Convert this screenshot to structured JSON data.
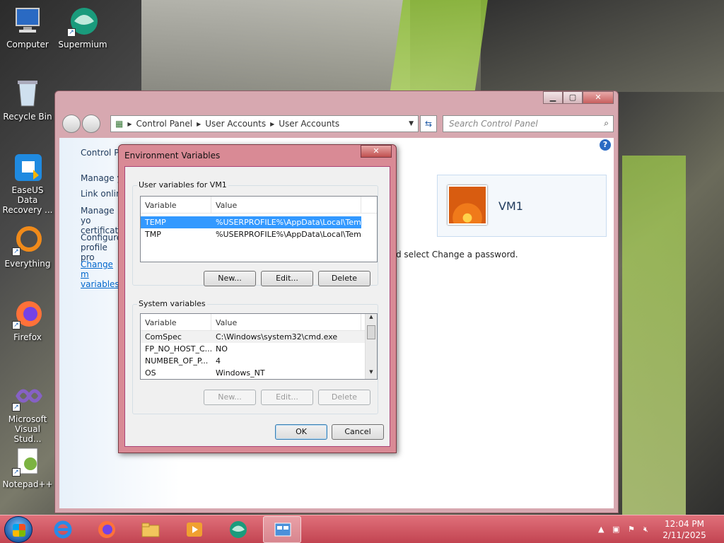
{
  "desktop": {
    "icons": [
      {
        "label": "Computer"
      },
      {
        "label": "Supermium"
      },
      {
        "label": "Recycle Bin"
      },
      {
        "label": "EaseUS Data Recovery ..."
      },
      {
        "label": "Everything"
      },
      {
        "label": "Firefox"
      },
      {
        "label": "Microsoft Visual Stud..."
      },
      {
        "label": "Notepad++"
      }
    ]
  },
  "window": {
    "breadcrumb": [
      "Control Panel",
      "User Accounts",
      "User Accounts"
    ],
    "search_placeholder": "Search Control Panel",
    "left_pane": {
      "items": [
        "Control Pa",
        "Manage yo",
        "Link onlin",
        "Manage yo certificate",
        "Configure profile pro"
      ],
      "link": "Change m variables"
    },
    "user": {
      "name": "VM1"
    },
    "body_text": "d select Change a password."
  },
  "dialog": {
    "title": "Environment Variables",
    "user_group_label": "User variables for VM1",
    "columns": [
      "Variable",
      "Value"
    ],
    "user_vars": [
      {
        "name": "TEMP",
        "value": "%USERPROFILE%\\AppData\\Local\\Temp"
      },
      {
        "name": "TMP",
        "value": "%USERPROFILE%\\AppData\\Local\\Temp"
      }
    ],
    "user_buttons": {
      "new": "New...",
      "edit": "Edit...",
      "delete": "Delete"
    },
    "system_group_label": "System variables",
    "system_vars": [
      {
        "name": "ComSpec",
        "value": "C:\\Windows\\system32\\cmd.exe"
      },
      {
        "name": "FP_NO_HOST_C...",
        "value": "NO"
      },
      {
        "name": "NUMBER_OF_P...",
        "value": "4"
      },
      {
        "name": "OS",
        "value": "Windows_NT"
      }
    ],
    "system_buttons": {
      "new": "New...",
      "edit": "Edit...",
      "delete": "Delete"
    },
    "ok": "OK",
    "cancel": "Cancel"
  },
  "taskbar": {
    "time": "12:04 PM",
    "date": "2/11/2025"
  },
  "colors": {
    "accent": "#c24451",
    "selection": "#3399ff"
  }
}
